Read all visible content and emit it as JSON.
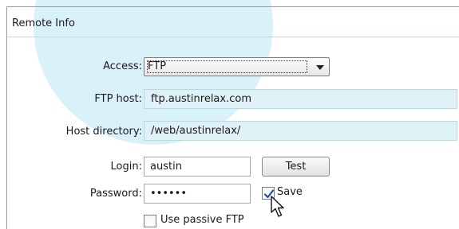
{
  "panel": {
    "title": "Remote Info"
  },
  "access": {
    "label": "Access:",
    "selected": "FTP"
  },
  "ftp_host": {
    "label": "FTP host:",
    "value": "ftp.austinrelax.com"
  },
  "host_directory": {
    "label": "Host directory:",
    "value": "/web/austinrelax/"
  },
  "login": {
    "label": "Login:",
    "value": "austin"
  },
  "test_button": {
    "label": "Test"
  },
  "password": {
    "label": "Password:",
    "value": "••••••"
  },
  "save_checkbox": {
    "label": "Save",
    "checked": true
  },
  "passive_ftp_checkbox": {
    "label": "Use passive FTP",
    "checked": false
  },
  "colors": {
    "accent_circle": "#d9f1f9",
    "readonly_field_bg": "#dff2f8",
    "checkmark": "#1e4fb0"
  },
  "icons": {
    "dropdown": "chevron-down-icon",
    "checkmark": "check-icon",
    "pointer": "mouse-pointer-icon"
  }
}
